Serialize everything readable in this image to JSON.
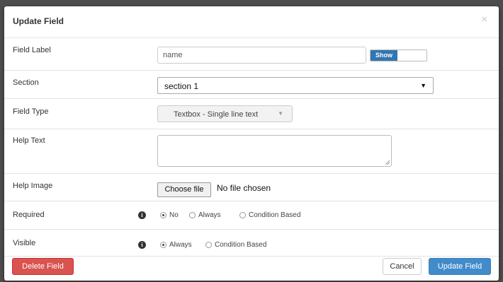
{
  "modal": {
    "title": "Update Field",
    "close_glyph": "×"
  },
  "rows": {
    "field_label": {
      "label": "Field Label",
      "value": "name",
      "toggle_label": "Show"
    },
    "section": {
      "label": "Section",
      "selected": "section 1"
    },
    "field_type": {
      "label": "Field Type",
      "selected": "Textbox - Single line text"
    },
    "help_text": {
      "label": "Help Text",
      "value": ""
    },
    "help_image": {
      "label": "Help Image",
      "button_label": "Choose file",
      "status": "No file chosen"
    },
    "required": {
      "label": "Required",
      "options": [
        {
          "label": "No",
          "checked": true
        },
        {
          "label": "Always",
          "checked": false
        },
        {
          "label": "Condition Based",
          "checked": false
        }
      ]
    },
    "visible": {
      "label": "Visible",
      "options": [
        {
          "label": "Always",
          "checked": true
        },
        {
          "label": "Condition Based",
          "checked": false
        }
      ]
    }
  },
  "footer": {
    "delete_label": "Delete Field",
    "cancel_label": "Cancel",
    "update_label": "Update Field"
  },
  "colors": {
    "primary": "#428bca",
    "danger": "#d9534f",
    "toggle": "#3276b1"
  }
}
